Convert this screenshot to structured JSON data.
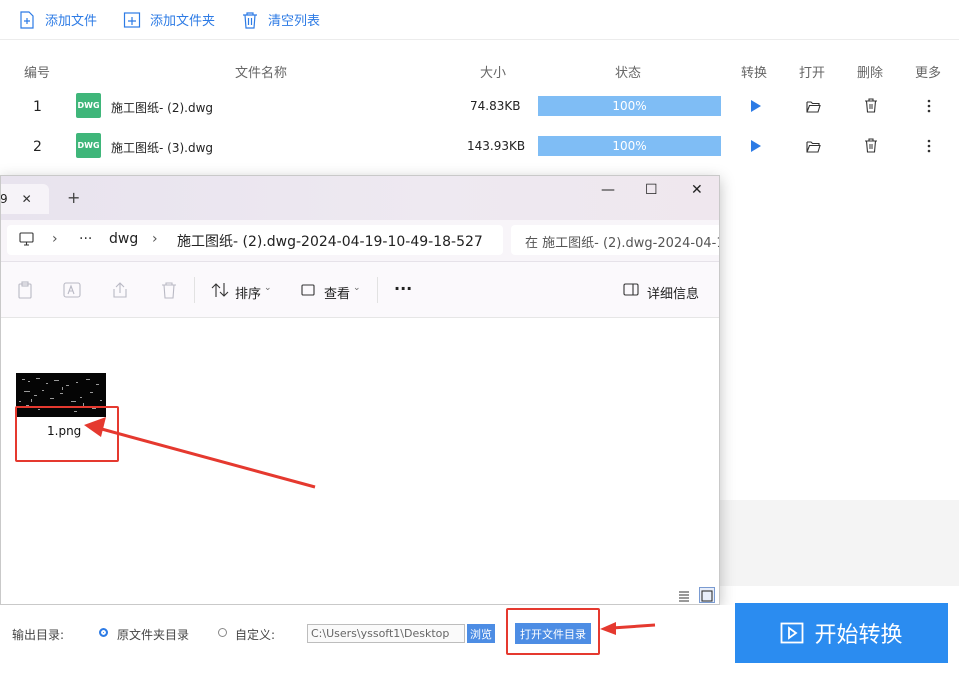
{
  "toolbar": {
    "add_file": "添加文件",
    "add_folder": "添加文件夹",
    "clear_list": "清空列表"
  },
  "table": {
    "headers": {
      "index": "编号",
      "name": "文件名称",
      "size": "大小",
      "status": "状态",
      "convert": "转换",
      "open": "打开",
      "delete": "删除",
      "more": "更多"
    },
    "rows": [
      {
        "index": "1",
        "badge": "DWG",
        "name": "施工图纸- (2).dwg",
        "size": "74.83KB",
        "progress": "100%"
      },
      {
        "index": "2",
        "badge": "DWG",
        "name": "施工图纸- (3).dwg",
        "size": "143.93KB",
        "progress": "100%"
      }
    ]
  },
  "explorer": {
    "tab_label": "9",
    "tab_close": "✕",
    "new_tab": "+",
    "minimize": "—",
    "maximize": "☐",
    "close": "✕",
    "breadcrumb": {
      "ellipsis": "···",
      "folder": "dwg",
      "current": "施工图纸- (2).dwg-2024-04-19-10-49-18-527"
    },
    "search_placeholder": "在 施工图纸- (2).dwg-2024-04-1",
    "commands": {
      "sort": "排序",
      "view": "查看",
      "more": "···",
      "details": "详细信息"
    },
    "file": {
      "name": "1.png"
    }
  },
  "bottom": {
    "output_dir_label": "输出目录:",
    "option_original": "原文件夹目录",
    "option_custom": "自定义:",
    "path_value": "C:\\Users\\yssoft1\\Desktop",
    "browse": "浏览",
    "open_dir": "打开文件目录",
    "start": "开始转换"
  },
  "colors": {
    "accent": "#2d7be5",
    "progress": "#7fbdf5",
    "start_button": "#2b8cf0",
    "annotation_red": "#e5392f",
    "dwg_badge": "#3fb67a"
  }
}
